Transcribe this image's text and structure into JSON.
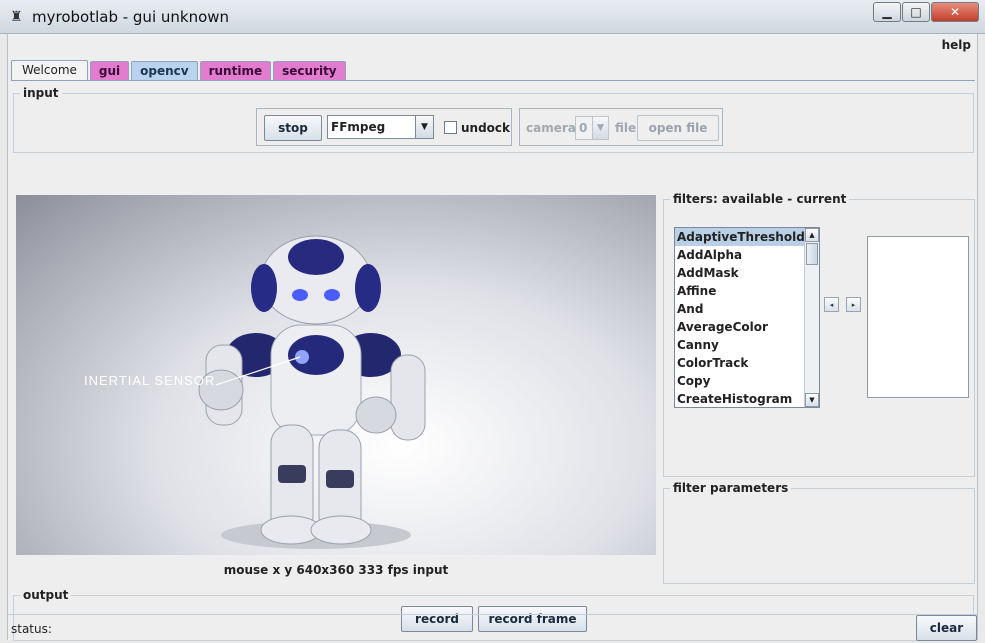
{
  "window": {
    "title": "myrobotlab - gui unknown",
    "app_icon": "robot-icon",
    "controls": {
      "minimize": "▁",
      "maximize": "□",
      "close": "✕"
    }
  },
  "menu": {
    "help": "help"
  },
  "tabs": [
    {
      "label": "Welcome",
      "color": "#f3f3f3",
      "selected": true
    },
    {
      "label": "gui",
      "color": "#e27ccf"
    },
    {
      "label": "opencv",
      "color": "#b9d3ee"
    },
    {
      "label": "runtime",
      "color": "#e27ccf"
    },
    {
      "label": "security",
      "color": "#e27ccf"
    }
  ],
  "input": {
    "title": "input",
    "stop_label": "stop",
    "grabber_value": "FFmpeg",
    "undock_label": "undock",
    "camera_label": "camera",
    "camera_value": "0",
    "file_label": "file",
    "open_file_label": "open file"
  },
  "video": {
    "overlay_text": "INERTIAL SENSOR",
    "caption": "mouse x y  640x360  333 fps  input"
  },
  "filters": {
    "title": "filters: available - current",
    "available": [
      "AdaptiveThreshold",
      "AddAlpha",
      "AddMask",
      "Affine",
      "And",
      "AverageColor",
      "Canny",
      "ColorTrack",
      "Copy",
      "CreateHistogram"
    ],
    "selected_index": 0,
    "move_left": "◂",
    "move_right": "▸"
  },
  "filter_parameters": {
    "title": "filter parameters"
  },
  "output": {
    "title": "output",
    "record_label": "record",
    "record_frame_label": "record frame"
  },
  "status": {
    "label": "status:",
    "clear_label": "clear"
  },
  "colors": {
    "tab_pink": "#e27ccf",
    "tab_blue": "#b9d3ee",
    "selection": "#b9cfe6",
    "robot_blue": "#2a2a8a"
  }
}
